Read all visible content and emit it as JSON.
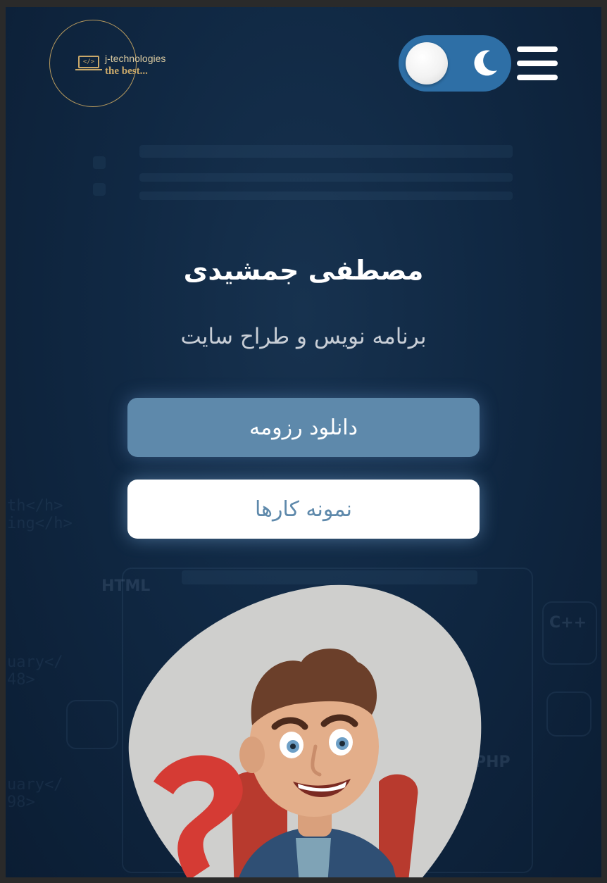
{
  "header": {
    "logo": {
      "name": "j-technologies",
      "tagline": "the best...",
      "laptop_glyph": "</>"
    },
    "theme_toggle": {
      "mode": "dark",
      "icon": "moon-icon"
    },
    "menu": {
      "icon": "hamburger-menu-icon"
    }
  },
  "hero": {
    "name": "مصطفی جمشیدی",
    "role": "برنامه نویس و طراح سایت",
    "buttons": {
      "resume": "دانلود رزومه",
      "portfolio": "نمونه کارها"
    }
  },
  "background_labels": {
    "html": "HTML",
    "cpp": "C++",
    "php": "PHP"
  },
  "colors": {
    "background": "#102843",
    "toggle": "#2e6fa6",
    "primary_button": "#5e89ab",
    "secondary_button": "#ffffff",
    "logo_gold": "#c9a86a",
    "avatar_blob": "#cfcfcd"
  }
}
